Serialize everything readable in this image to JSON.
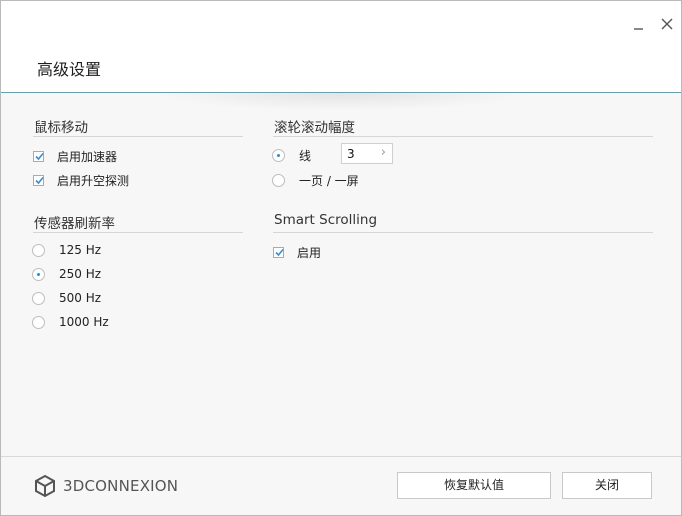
{
  "window": {
    "title": "高级设置",
    "minimize_glyph": "_",
    "close_glyph": "✕"
  },
  "mouse_movement": {
    "title": "鼠标移动",
    "options": [
      {
        "label": "启用加速器",
        "checked": true
      },
      {
        "label": "启用升空探测",
        "checked": true
      }
    ]
  },
  "sensor_rate": {
    "title": "传感器刷新率",
    "options": [
      {
        "label": "125 Hz",
        "selected": false
      },
      {
        "label": "250 Hz",
        "selected": true
      },
      {
        "label": "500 Hz",
        "selected": false
      },
      {
        "label": "1000 Hz",
        "selected": false
      }
    ]
  },
  "scroll_amount": {
    "title": "滚轮滚动幅度",
    "options": [
      {
        "label": "线",
        "selected": true
      },
      {
        "label": "一页 / 一屏",
        "selected": false
      }
    ],
    "lines_value": "3"
  },
  "smart_scrolling": {
    "title": "Smart Scrolling",
    "enable_label": "启用",
    "checked": true
  },
  "footer": {
    "brand": "3DCONNEXION",
    "reset_button": "恢复默认值",
    "close_button": "关闭"
  },
  "colors": {
    "accent": "#3cb2c6",
    "radio_dot": "#2a8fd6",
    "check": "#3a8fd0"
  }
}
